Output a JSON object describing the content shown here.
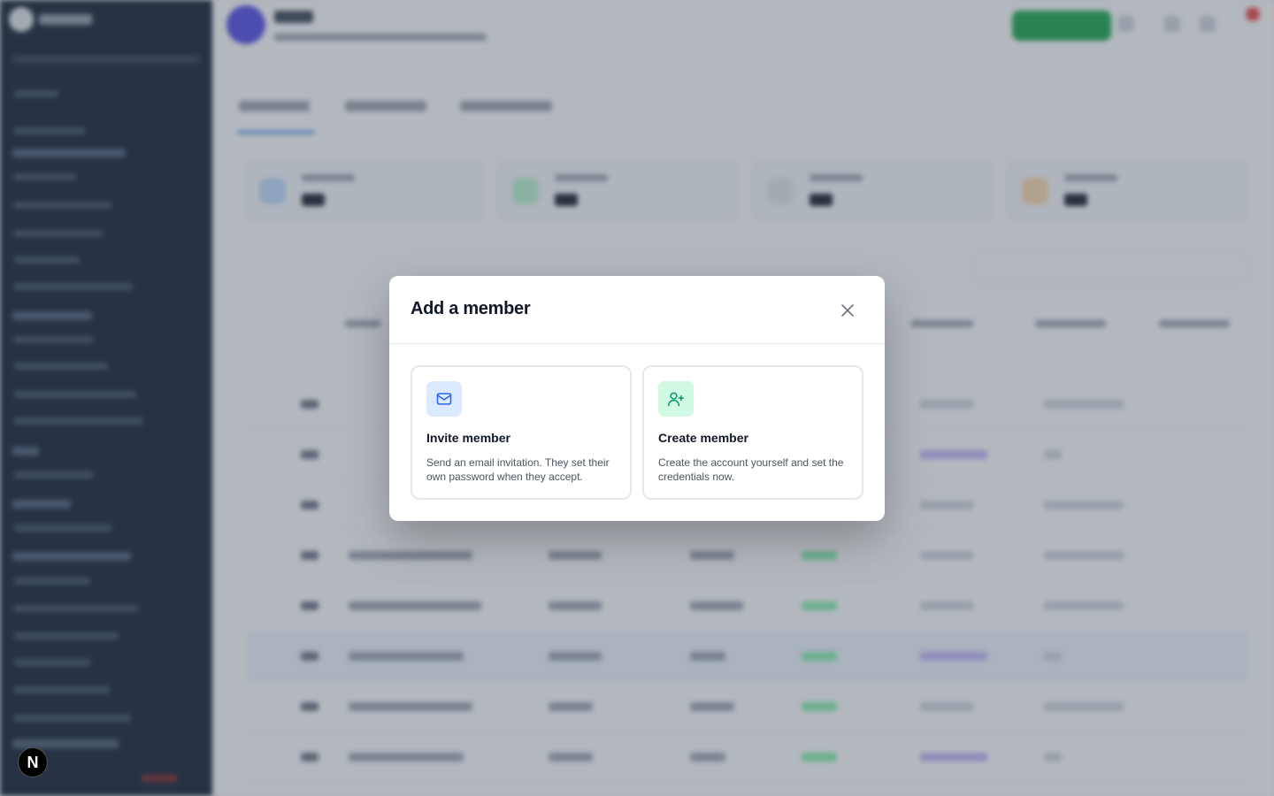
{
  "modal": {
    "title": "Add a member",
    "close_icon": "close-icon",
    "options": [
      {
        "title": "Invite member",
        "description": "Send an email invitation. They set their own password when they accept.",
        "icon": "mail-icon",
        "accent": "#2563eb"
      },
      {
        "title": "Create member",
        "description": "Create the account yourself and set the credentials now.",
        "icon": "user-plus-icon",
        "accent": "#059669"
      }
    ]
  },
  "floating_badge": {
    "label": "N"
  },
  "colors": {
    "sidebar": "#0f1a2e",
    "primary_green": "#16a34a",
    "accent_blue": "#3b82f6"
  }
}
